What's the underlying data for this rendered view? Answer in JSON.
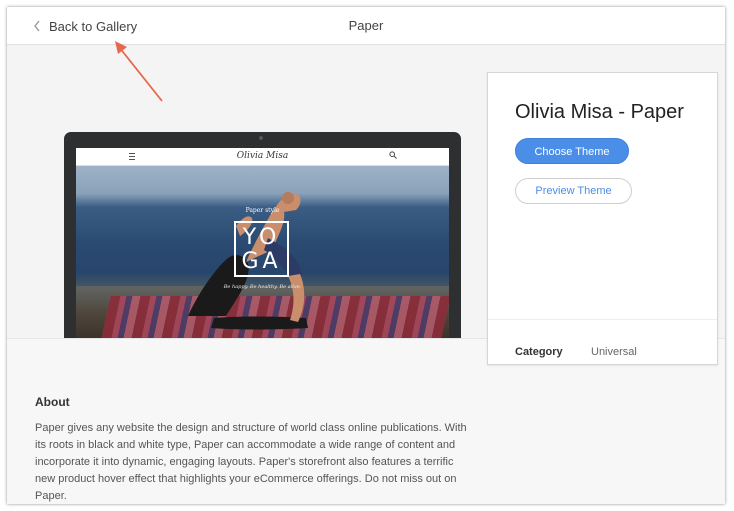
{
  "header": {
    "back_label": "Back to Gallery",
    "title": "Paper"
  },
  "preview": {
    "site_logo": "Olivia Misa",
    "hero_small": "Paper style",
    "hero_word_top": "YO",
    "hero_word_bottom": "GA",
    "hero_tagline": "Be happy. Be healthy. Be alive."
  },
  "card": {
    "theme_title": "Olivia Misa - Paper",
    "choose_label": "Choose Theme",
    "preview_label": "Preview Theme",
    "category_label": "Category",
    "category_value": "Universal"
  },
  "about": {
    "heading": "About",
    "text": "Paper gives any website the design and structure of world class online publications. With its roots in black and white type, Paper can accommodate a wide range of content and incorporate it into dynamic, engaging layouts. Paper's storefront also features a terrific new product hover effect that highlights your eCommerce offerings. Do not miss out on Paper."
  },
  "colors": {
    "accent": "#4a8ee8",
    "annotation_arrow": "#e8684f"
  },
  "icons": [
    "chevron-left-icon",
    "annotation-arrow",
    "hamburger-icon",
    "search-icon"
  ]
}
